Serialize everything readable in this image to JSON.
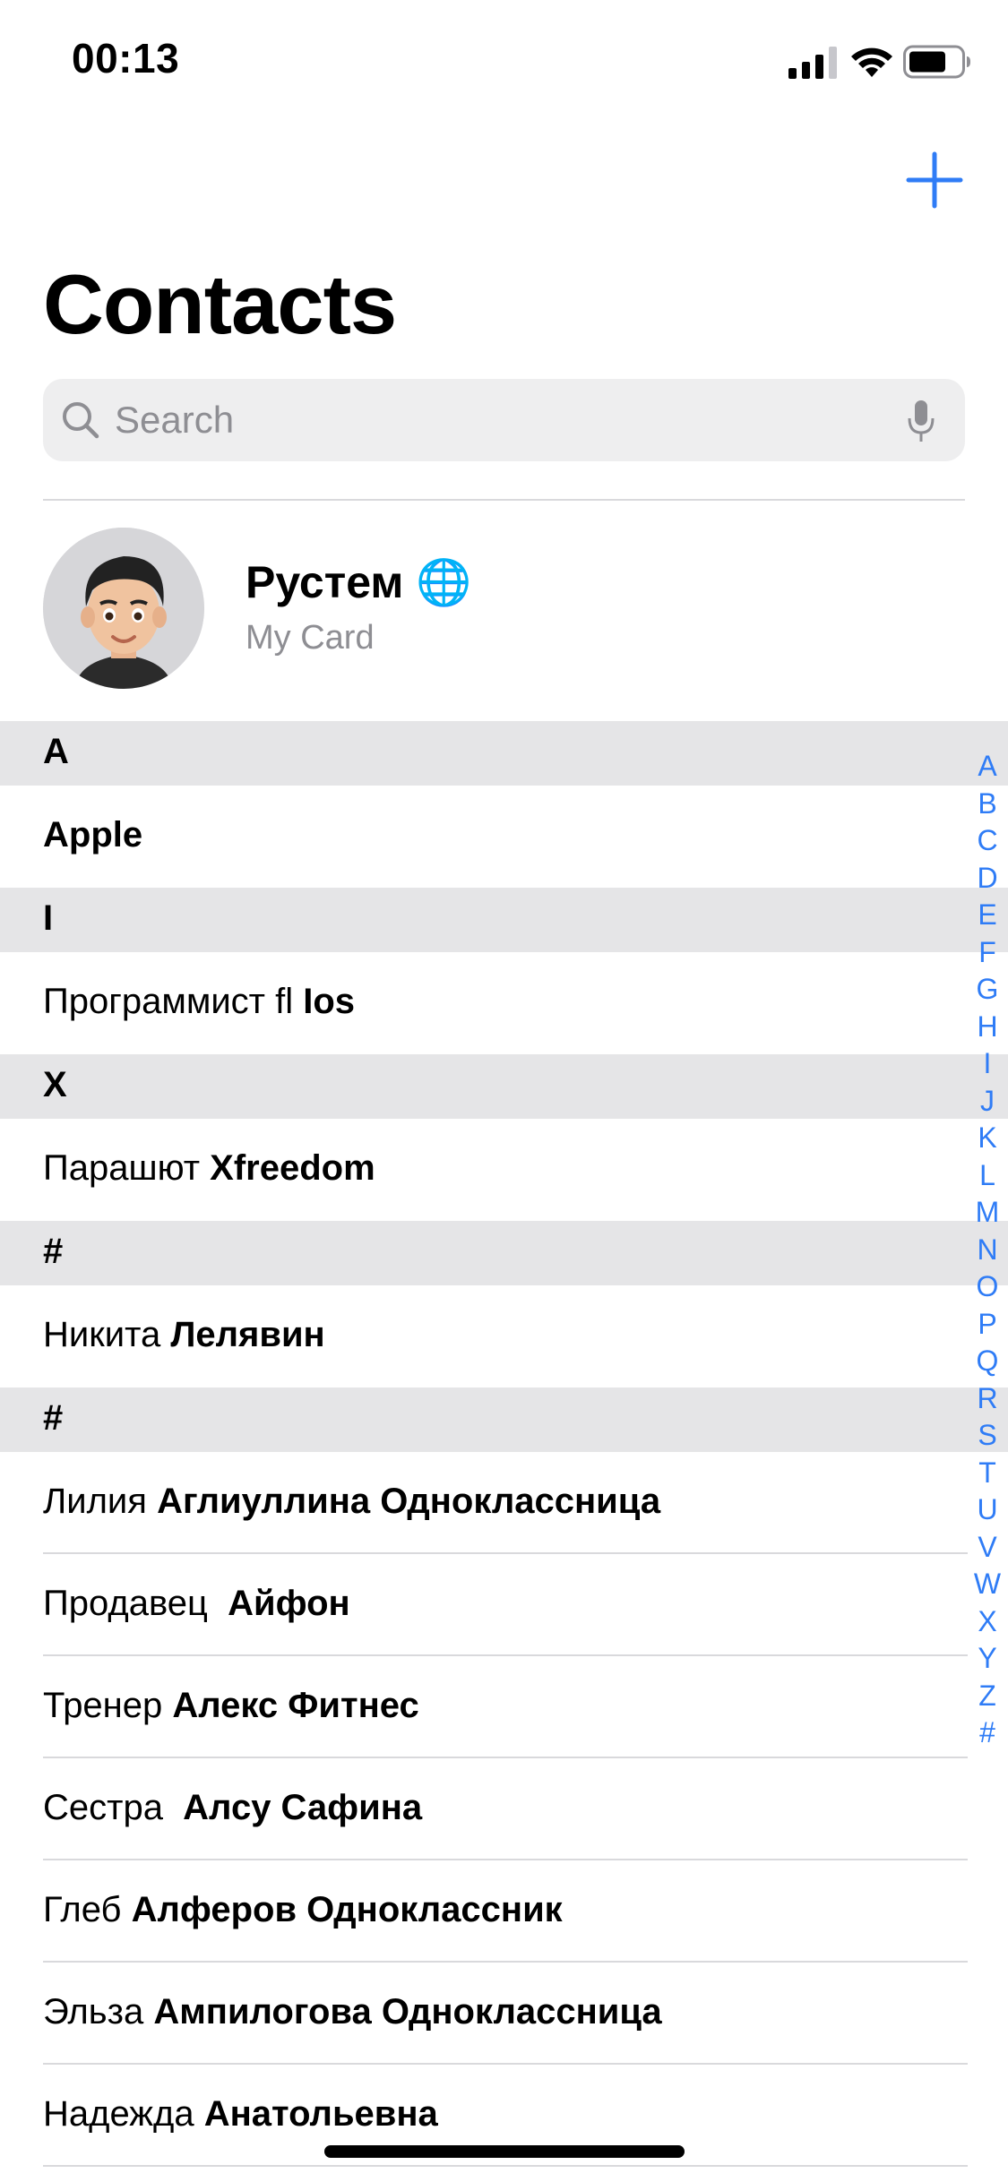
{
  "status_bar": {
    "time": "00:13"
  },
  "header": {
    "title": "Contacts",
    "add_icon": "plus-icon",
    "accent_color": "#2f7cf6"
  },
  "search": {
    "placeholder": "Search",
    "value": ""
  },
  "my_card": {
    "name": "Рустем 🌐",
    "subtitle": "My Card"
  },
  "sections": [
    {
      "header": "A",
      "rows": [
        {
          "first": "",
          "last": "Apple"
        }
      ]
    },
    {
      "header": "I",
      "rows": [
        {
          "first": "Программист fl ",
          "last": "Ios"
        }
      ]
    },
    {
      "header": "X",
      "rows": [
        {
          "first": "Парашют ",
          "last": "Xfreedom"
        }
      ]
    },
    {
      "header": "#",
      "rows": [
        {
          "first": "Никита ",
          "last": "Лелявин"
        }
      ]
    },
    {
      "header": "#",
      "rows": [
        {
          "first": "Лилия ",
          "last": "Аглиуллина Одноклассница"
        },
        {
          "first": "Продавец  ",
          "last": "Айфон"
        },
        {
          "first": "Тренер ",
          "last": "Алекс Фитнес"
        },
        {
          "first": "Сестра  ",
          "last": "Алсу Сафина"
        },
        {
          "first": "Глеб ",
          "last": "Алферов Одноклассник"
        },
        {
          "first": "Эльза ",
          "last": "Ампилогова Одноклассница"
        },
        {
          "first": "Надежда ",
          "last": "Анатольевна"
        }
      ]
    }
  ],
  "index_letters": [
    "A",
    "B",
    "C",
    "D",
    "E",
    "F",
    "G",
    "H",
    "I",
    "J",
    "K",
    "L",
    "M",
    "N",
    "O",
    "P",
    "Q",
    "R",
    "S",
    "T",
    "U",
    "V",
    "W",
    "X",
    "Y",
    "Z",
    "#"
  ]
}
